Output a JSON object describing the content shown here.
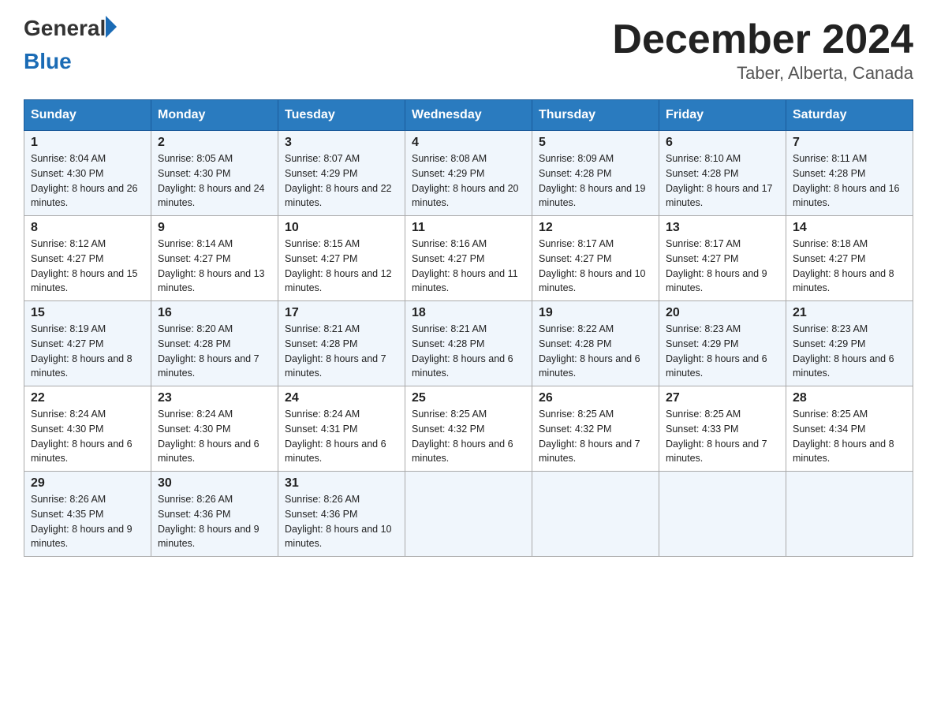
{
  "logo": {
    "general": "General",
    "blue": "Blue"
  },
  "title": {
    "month_year": "December 2024",
    "location": "Taber, Alberta, Canada"
  },
  "days_of_week": [
    "Sunday",
    "Monday",
    "Tuesday",
    "Wednesday",
    "Thursday",
    "Friday",
    "Saturday"
  ],
  "weeks": [
    [
      {
        "day": "1",
        "sunrise": "8:04 AM",
        "sunset": "4:30 PM",
        "daylight": "8 hours and 26 minutes."
      },
      {
        "day": "2",
        "sunrise": "8:05 AM",
        "sunset": "4:30 PM",
        "daylight": "8 hours and 24 minutes."
      },
      {
        "day": "3",
        "sunrise": "8:07 AM",
        "sunset": "4:29 PM",
        "daylight": "8 hours and 22 minutes."
      },
      {
        "day": "4",
        "sunrise": "8:08 AM",
        "sunset": "4:29 PM",
        "daylight": "8 hours and 20 minutes."
      },
      {
        "day": "5",
        "sunrise": "8:09 AM",
        "sunset": "4:28 PM",
        "daylight": "8 hours and 19 minutes."
      },
      {
        "day": "6",
        "sunrise": "8:10 AM",
        "sunset": "4:28 PM",
        "daylight": "8 hours and 17 minutes."
      },
      {
        "day": "7",
        "sunrise": "8:11 AM",
        "sunset": "4:28 PM",
        "daylight": "8 hours and 16 minutes."
      }
    ],
    [
      {
        "day": "8",
        "sunrise": "8:12 AM",
        "sunset": "4:27 PM",
        "daylight": "8 hours and 15 minutes."
      },
      {
        "day": "9",
        "sunrise": "8:14 AM",
        "sunset": "4:27 PM",
        "daylight": "8 hours and 13 minutes."
      },
      {
        "day": "10",
        "sunrise": "8:15 AM",
        "sunset": "4:27 PM",
        "daylight": "8 hours and 12 minutes."
      },
      {
        "day": "11",
        "sunrise": "8:16 AM",
        "sunset": "4:27 PM",
        "daylight": "8 hours and 11 minutes."
      },
      {
        "day": "12",
        "sunrise": "8:17 AM",
        "sunset": "4:27 PM",
        "daylight": "8 hours and 10 minutes."
      },
      {
        "day": "13",
        "sunrise": "8:17 AM",
        "sunset": "4:27 PM",
        "daylight": "8 hours and 9 minutes."
      },
      {
        "day": "14",
        "sunrise": "8:18 AM",
        "sunset": "4:27 PM",
        "daylight": "8 hours and 8 minutes."
      }
    ],
    [
      {
        "day": "15",
        "sunrise": "8:19 AM",
        "sunset": "4:27 PM",
        "daylight": "8 hours and 8 minutes."
      },
      {
        "day": "16",
        "sunrise": "8:20 AM",
        "sunset": "4:28 PM",
        "daylight": "8 hours and 7 minutes."
      },
      {
        "day": "17",
        "sunrise": "8:21 AM",
        "sunset": "4:28 PM",
        "daylight": "8 hours and 7 minutes."
      },
      {
        "day": "18",
        "sunrise": "8:21 AM",
        "sunset": "4:28 PM",
        "daylight": "8 hours and 6 minutes."
      },
      {
        "day": "19",
        "sunrise": "8:22 AM",
        "sunset": "4:28 PM",
        "daylight": "8 hours and 6 minutes."
      },
      {
        "day": "20",
        "sunrise": "8:23 AM",
        "sunset": "4:29 PM",
        "daylight": "8 hours and 6 minutes."
      },
      {
        "day": "21",
        "sunrise": "8:23 AM",
        "sunset": "4:29 PM",
        "daylight": "8 hours and 6 minutes."
      }
    ],
    [
      {
        "day": "22",
        "sunrise": "8:24 AM",
        "sunset": "4:30 PM",
        "daylight": "8 hours and 6 minutes."
      },
      {
        "day": "23",
        "sunrise": "8:24 AM",
        "sunset": "4:30 PM",
        "daylight": "8 hours and 6 minutes."
      },
      {
        "day": "24",
        "sunrise": "8:24 AM",
        "sunset": "4:31 PM",
        "daylight": "8 hours and 6 minutes."
      },
      {
        "day": "25",
        "sunrise": "8:25 AM",
        "sunset": "4:32 PM",
        "daylight": "8 hours and 6 minutes."
      },
      {
        "day": "26",
        "sunrise": "8:25 AM",
        "sunset": "4:32 PM",
        "daylight": "8 hours and 7 minutes."
      },
      {
        "day": "27",
        "sunrise": "8:25 AM",
        "sunset": "4:33 PM",
        "daylight": "8 hours and 7 minutes."
      },
      {
        "day": "28",
        "sunrise": "8:25 AM",
        "sunset": "4:34 PM",
        "daylight": "8 hours and 8 minutes."
      }
    ],
    [
      {
        "day": "29",
        "sunrise": "8:26 AM",
        "sunset": "4:35 PM",
        "daylight": "8 hours and 9 minutes."
      },
      {
        "day": "30",
        "sunrise": "8:26 AM",
        "sunset": "4:36 PM",
        "daylight": "8 hours and 9 minutes."
      },
      {
        "day": "31",
        "sunrise": "8:26 AM",
        "sunset": "4:36 PM",
        "daylight": "8 hours and 10 minutes."
      },
      {
        "day": "",
        "sunrise": "",
        "sunset": "",
        "daylight": ""
      },
      {
        "day": "",
        "sunrise": "",
        "sunset": "",
        "daylight": ""
      },
      {
        "day": "",
        "sunrise": "",
        "sunset": "",
        "daylight": ""
      },
      {
        "day": "",
        "sunrise": "",
        "sunset": "",
        "daylight": ""
      }
    ]
  ]
}
